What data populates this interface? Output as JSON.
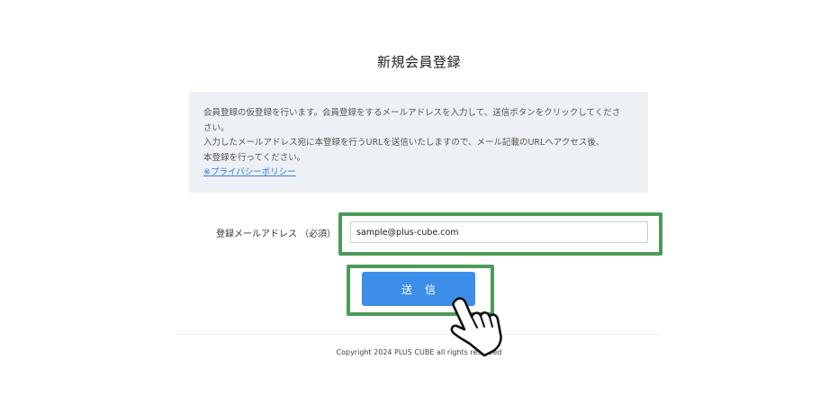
{
  "page": {
    "title": "新規会員登録"
  },
  "notice": {
    "line1": "会員登録の仮登録を行います。会員登録をするメールアドレスを入力して、送信ボタンをクリックしてくださ",
    "line2": "さい。",
    "line3": "入力したメールアドレス宛に本登録を行うURLを送信いたしますので、メール記載のURLへアクセス後、",
    "line4": "本登録を行ってください。",
    "privacy_link": "※プライバシーポリシー"
  },
  "form": {
    "email_label": "登録メールアドレス （必須）",
    "email_value": "sample@plus-cube.com"
  },
  "submit": {
    "label": "送信"
  },
  "footer": {
    "copyright": "Copyright 2024 PLUS CUBE all rights reserved"
  },
  "colors": {
    "highlight": "#4f9a59",
    "button": "#3d8ee8",
    "notice_bg": "#edf0f4",
    "link": "#2a7be4"
  },
  "icons": {
    "cursor": "pointing-hand-icon"
  }
}
